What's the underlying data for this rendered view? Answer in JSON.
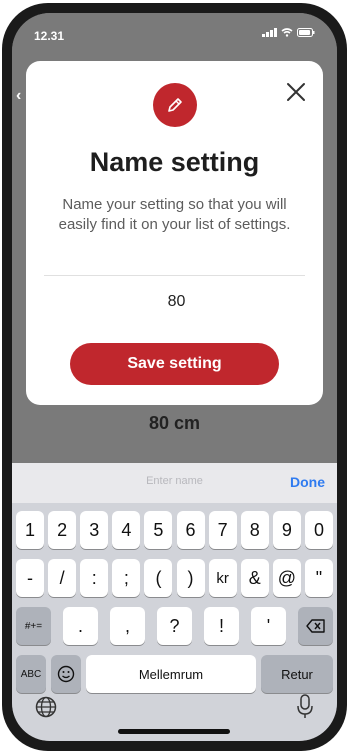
{
  "status": {
    "time": "12.31"
  },
  "background": {
    "back_chevron": "‹",
    "value_text": "80 cm"
  },
  "modal": {
    "icon": "pencil-icon",
    "close_icon": "close-icon",
    "title": "Name setting",
    "description": "Name your setting so that you will easily find it on your list of settings.",
    "input_value": "80",
    "save_label": "Save setting"
  },
  "keyboard": {
    "placeholder": "Enter name",
    "done_label": "Done",
    "row1": [
      "1",
      "2",
      "3",
      "4",
      "5",
      "6",
      "7",
      "8",
      "9",
      "0"
    ],
    "row2": [
      "-",
      "/",
      ":",
      ";",
      "(",
      ")",
      "kr",
      "&",
      "@",
      "\""
    ],
    "row3_left": "#+=",
    "row3": [
      ".",
      ",",
      "?",
      "!",
      "'"
    ],
    "row3_right_icon": "backspace-icon",
    "abc_label": "ABC",
    "emoji_icon": "emoji-icon",
    "space_label": "Mellemrum",
    "return_label": "Retur",
    "globe_icon": "globe-icon",
    "mic_icon": "mic-icon"
  },
  "colors": {
    "accent": "#c0272d",
    "done_blue": "#2f7bf0"
  }
}
